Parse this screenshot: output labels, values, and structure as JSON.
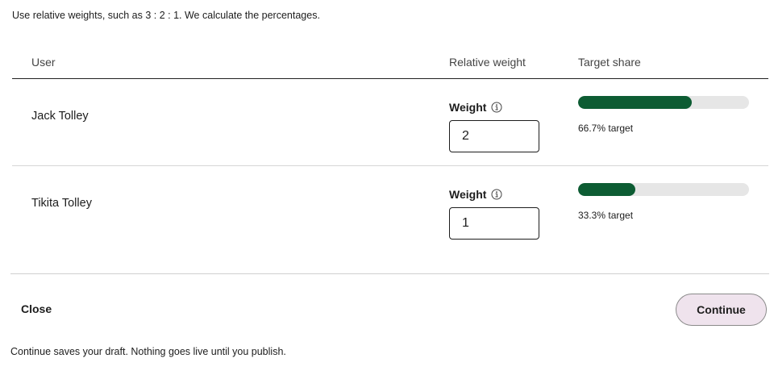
{
  "intro": "Use relative weights, such as 3 : 2 : 1. We calculate the percentages.",
  "table": {
    "headers": {
      "user": "User",
      "weight": "Relative weight",
      "share": "Target share"
    },
    "rows": [
      {
        "name": "Jack Tolley",
        "weight_label": "Weight",
        "weight_value": "2",
        "share_percent": 66.7,
        "share_text": "66.7% target"
      },
      {
        "name": "Tikita Tolley",
        "weight_label": "Weight",
        "weight_value": "1",
        "share_percent": 33.3,
        "share_text": "33.3% target"
      }
    ]
  },
  "icons": {
    "info": "info-icon"
  },
  "colors": {
    "bar_fill": "#0d5c33",
    "bar_track": "#e6e6e6",
    "continue_bg": "#efe3ed"
  },
  "footer": {
    "close_label": "Close",
    "continue_label": "Continue",
    "note": "Continue saves your draft. Nothing goes live until you publish."
  }
}
